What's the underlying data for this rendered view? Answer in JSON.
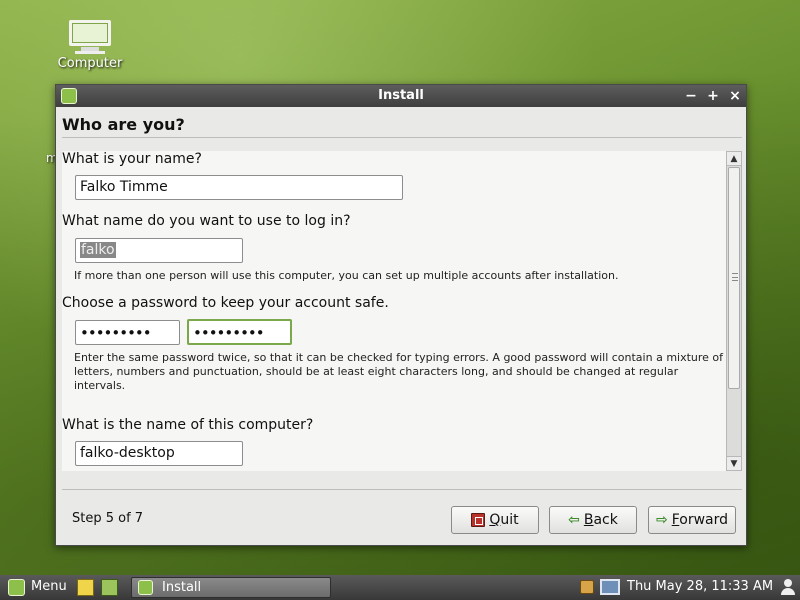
{
  "desktop": {
    "icon_label": "Computer",
    "stray_text": "m"
  },
  "window": {
    "title": "Install",
    "controls": {
      "minimize": "−",
      "maximize": "+",
      "close": "×"
    }
  },
  "page": {
    "heading": "Who are you?",
    "name_question": "What is your name?",
    "name_value": "Falko Timme",
    "login_question": "What name do you want to use to log in?",
    "login_value": "falko",
    "login_hint": "If more than one person will use this computer, you can set up multiple accounts after installation.",
    "password_question": "Choose a password to keep your account safe.",
    "password_value": "•••••••••",
    "password_confirm_value": "•••••••••",
    "password_hint": "Enter the same password twice, so that it can be checked for typing errors. A good password will contain a mixture of letters, numbers and punctuation, should be at least eight characters long, and should be changed at regular intervals.",
    "computer_question": "What is the name of this computer?",
    "computer_value": "falko-desktop"
  },
  "footer": {
    "step": "Step 5 of 7",
    "quit_first": "Q",
    "quit_rest": "uit",
    "back_first": "B",
    "back_rest": "ack",
    "forward_first": "F",
    "forward_rest": "orward"
  },
  "taskbar": {
    "menu_label": "Menu",
    "task_label": "Install",
    "clock": "Thu May 28, 11:33 AM"
  }
}
